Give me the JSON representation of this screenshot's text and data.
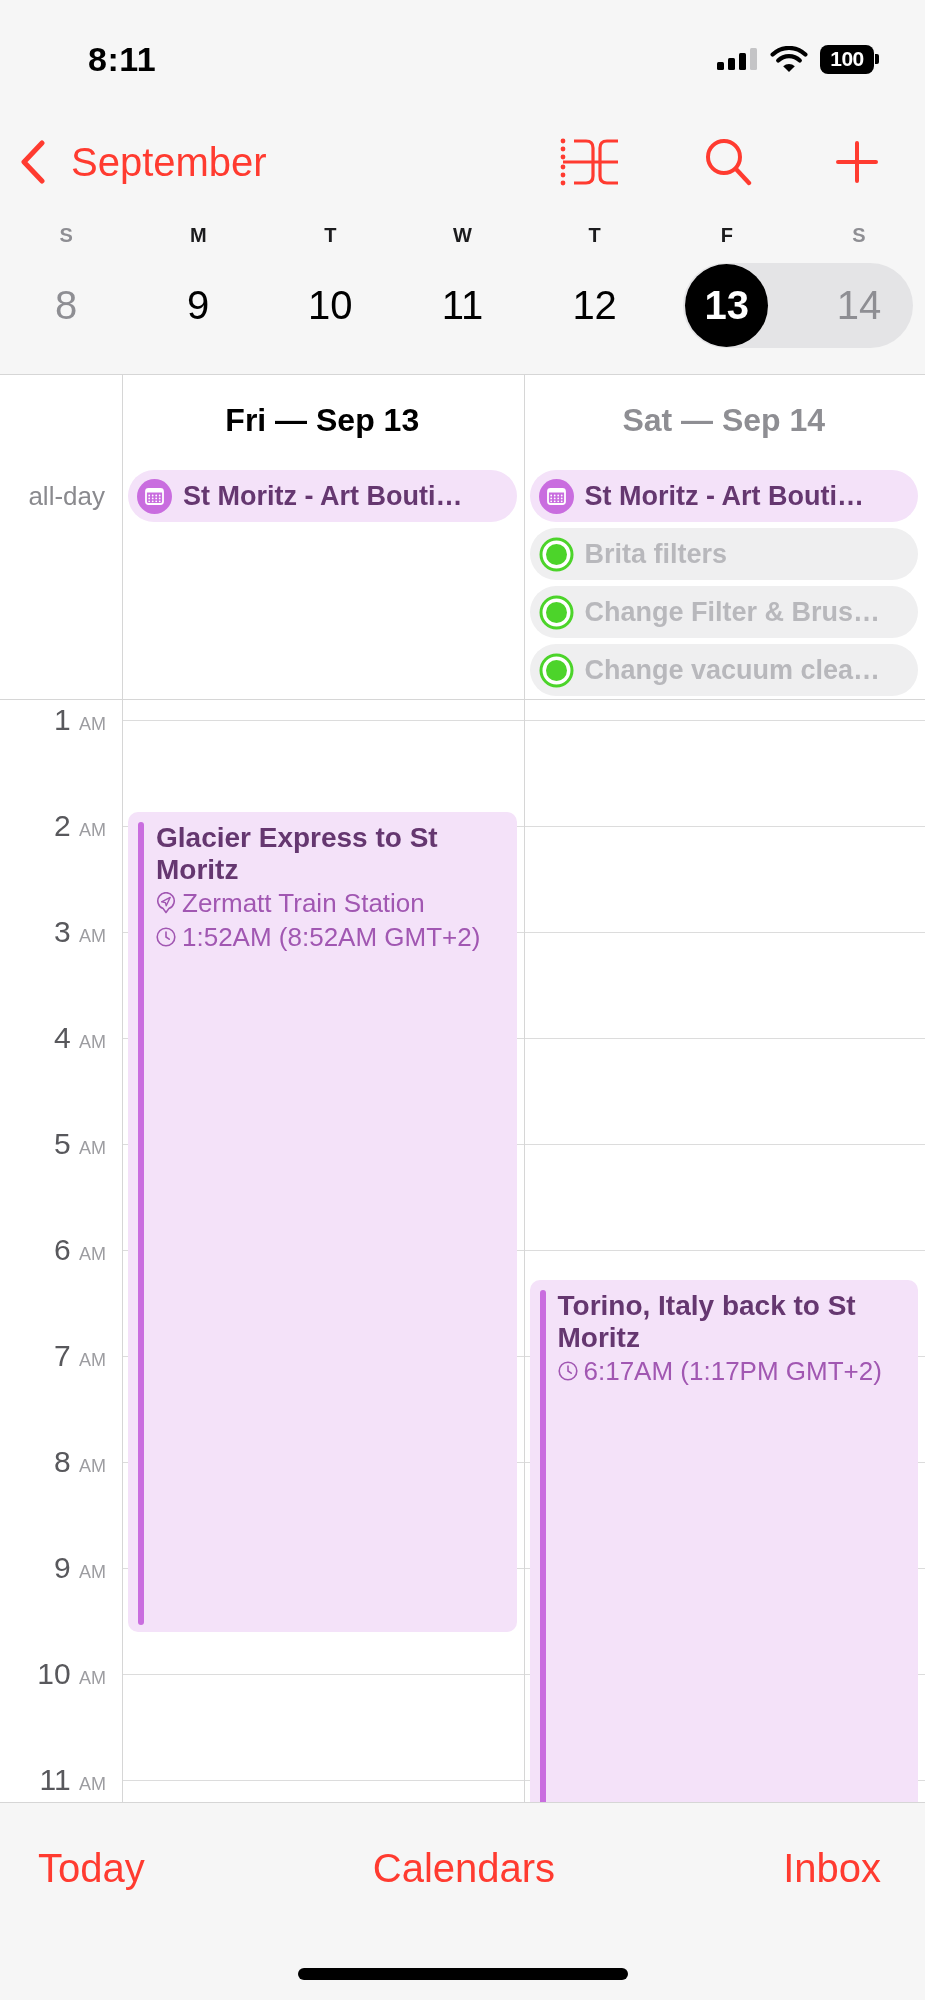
{
  "status_bar": {
    "time": "8:11",
    "battery": "100"
  },
  "nav": {
    "back_label": "September"
  },
  "week": [
    {
      "letter": "S",
      "number": "8",
      "weekend": true,
      "selected": false,
      "in_view": false
    },
    {
      "letter": "M",
      "number": "9",
      "weekend": false,
      "selected": false,
      "in_view": false
    },
    {
      "letter": "T",
      "number": "10",
      "weekend": false,
      "selected": false,
      "in_view": false
    },
    {
      "letter": "W",
      "number": "11",
      "weekend": false,
      "selected": false,
      "in_view": false
    },
    {
      "letter": "T",
      "number": "12",
      "weekend": false,
      "selected": false,
      "in_view": false
    },
    {
      "letter": "F",
      "number": "13",
      "weekend": false,
      "selected": true,
      "in_view": true
    },
    {
      "letter": "S",
      "number": "14",
      "weekend": true,
      "selected": false,
      "in_view": true
    }
  ],
  "all_day_label": "all-day",
  "days": [
    {
      "title": "Fri — Sep 13",
      "weekend": false,
      "all_day": [
        {
          "kind": "event",
          "title": "St Moritz - Art Bouti…",
          "color": "#c96ddf",
          "completed": false
        }
      ],
      "events": [
        {
          "title": "Glacier Express to St Moritz",
          "location": "Zermatt Train Station",
          "time": "1:52AM (8:52AM GMT+2)",
          "color": "#c96ddf"
        }
      ]
    },
    {
      "title": "Sat — Sep 14",
      "weekend": true,
      "all_day": [
        {
          "kind": "event",
          "title": "St Moritz - Art Bouti…",
          "color": "#c96ddf",
          "completed": false
        },
        {
          "kind": "reminder",
          "title": "Brita filters",
          "color": "#4cd42a",
          "completed": true
        },
        {
          "kind": "reminder",
          "title": "Change Filter & Brus…",
          "color": "#4cd42a",
          "completed": true
        },
        {
          "kind": "reminder",
          "title": "Change vacuum clea…",
          "color": "#4cd42a",
          "completed": true
        }
      ],
      "events": [
        {
          "title": "Torino, Italy back to St Moritz",
          "time": "6:17AM (1:17PM GMT+2)",
          "color": "#c96ddf"
        }
      ]
    }
  ],
  "hours": [
    {
      "hour": "1",
      "period": "AM"
    },
    {
      "hour": "2",
      "period": "AM"
    },
    {
      "hour": "3",
      "period": "AM"
    },
    {
      "hour": "4",
      "period": "AM"
    },
    {
      "hour": "5",
      "period": "AM"
    },
    {
      "hour": "6",
      "period": "AM"
    },
    {
      "hour": "7",
      "period": "AM"
    },
    {
      "hour": "8",
      "period": "AM"
    },
    {
      "hour": "9",
      "period": "AM"
    },
    {
      "hour": "10",
      "period": "AM"
    },
    {
      "hour": "11",
      "period": "AM"
    }
  ],
  "toolbar": [
    "Today",
    "Calendars",
    "Inbox"
  ]
}
